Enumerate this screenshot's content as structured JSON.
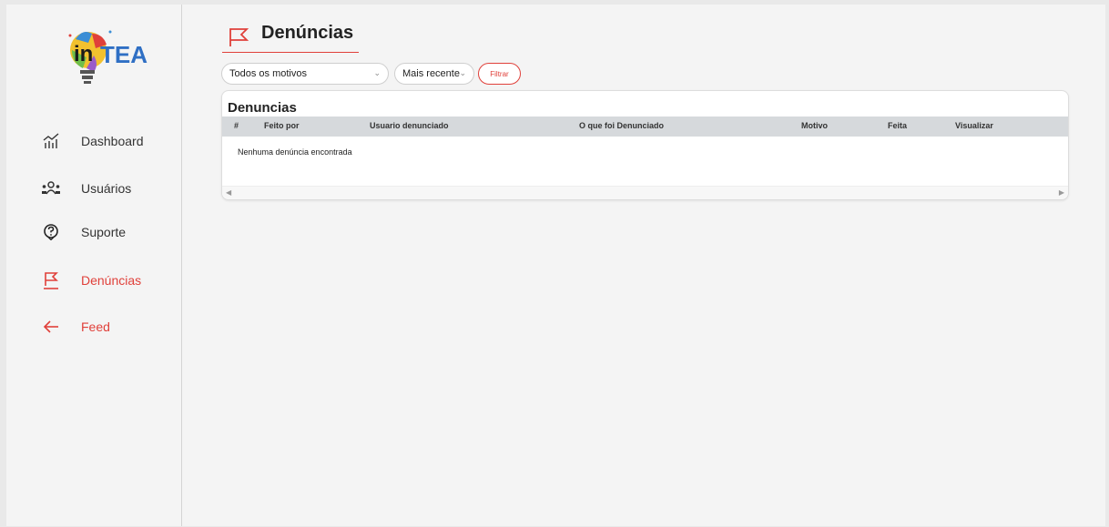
{
  "brand": {
    "logo_text": "inTEA"
  },
  "sidebar": {
    "items": [
      {
        "label": "Dashboard",
        "icon": "chart-icon"
      },
      {
        "label": "Usuários",
        "icon": "users-icon"
      },
      {
        "label": "Suporte",
        "icon": "help-icon"
      },
      {
        "label": "Denúncias",
        "icon": "flag-icon",
        "active": true
      },
      {
        "label": "Feed",
        "icon": "arrow-left-icon"
      }
    ]
  },
  "header": {
    "title": "Denúncias",
    "icon": "flag-icon"
  },
  "filters": {
    "reason": {
      "value": "Todos os motivos"
    },
    "sort": {
      "value": "Mais recente"
    },
    "filter_button": "Filtrar"
  },
  "table": {
    "title": "Denuncias",
    "columns": [
      "#",
      "Feito por",
      "Usuario denunciado",
      "O que foi Denunciado",
      "Motivo",
      "Feita",
      "Visualizar"
    ],
    "empty_message": "Nenhuma denúncia encontrada",
    "rows": []
  },
  "colors": {
    "accent": "#e0403a",
    "header_bg": "#d6d9dc",
    "sidebar_bg": "#f4f4f4"
  }
}
